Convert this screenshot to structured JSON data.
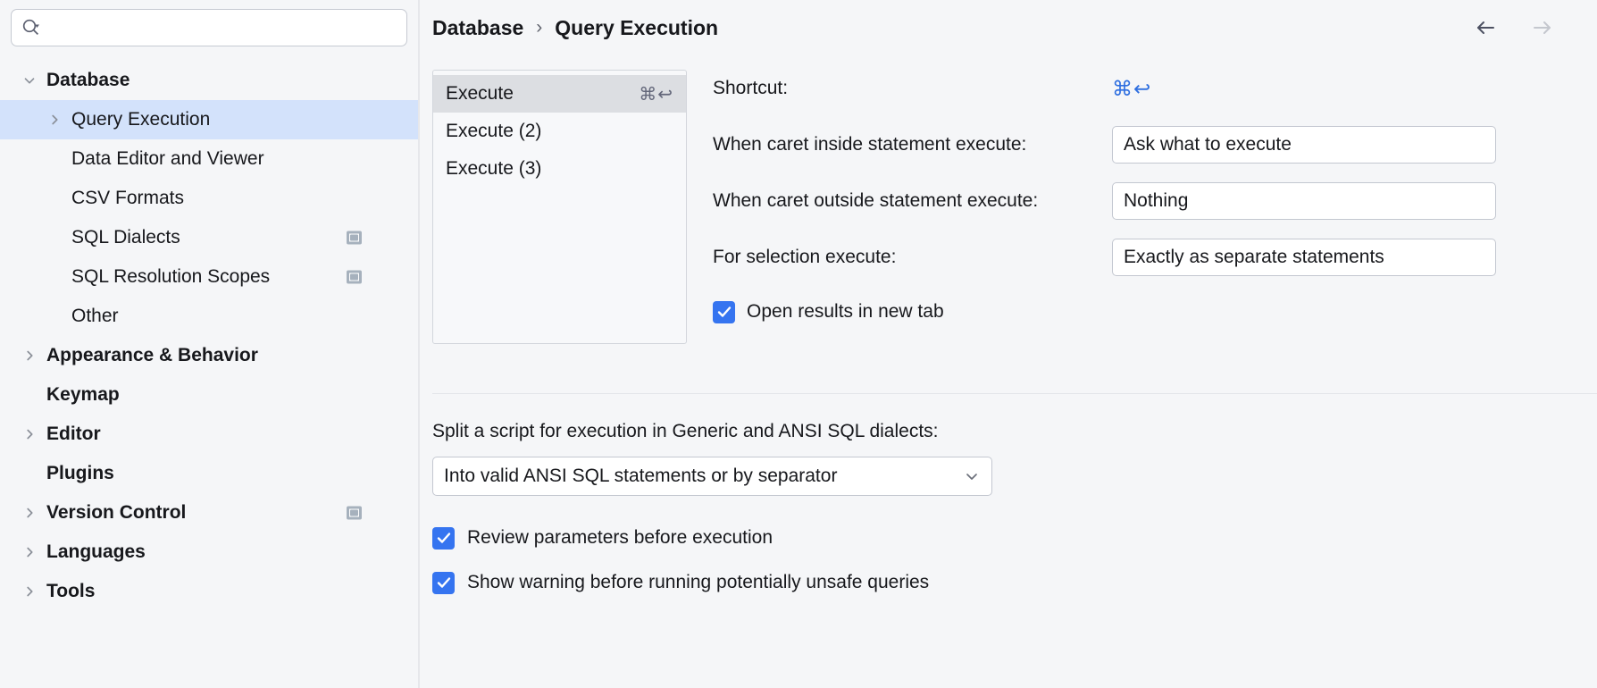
{
  "search": {
    "value": "",
    "placeholder": "",
    "icon": "search-icon"
  },
  "sidebar": {
    "items": [
      {
        "label": "Database",
        "level": 0,
        "bold": true,
        "twisty": "chevron-down",
        "selected": false,
        "badge": false
      },
      {
        "label": "Query Execution",
        "level": 1,
        "bold": false,
        "twisty": "chevron-right",
        "selected": true,
        "badge": false
      },
      {
        "label": "Data Editor and Viewer",
        "level": 1,
        "bold": false,
        "twisty": "none",
        "selected": false,
        "badge": false
      },
      {
        "label": "CSV Formats",
        "level": 1,
        "bold": false,
        "twisty": "none",
        "selected": false,
        "badge": false
      },
      {
        "label": "SQL Dialects",
        "level": 1,
        "bold": false,
        "twisty": "none",
        "selected": false,
        "badge": true
      },
      {
        "label": "SQL Resolution Scopes",
        "level": 1,
        "bold": false,
        "twisty": "none",
        "selected": false,
        "badge": true
      },
      {
        "label": "Other",
        "level": 1,
        "bold": false,
        "twisty": "none",
        "selected": false,
        "badge": false
      },
      {
        "label": "Appearance & Behavior",
        "level": 0,
        "bold": true,
        "twisty": "chevron-right",
        "selected": false,
        "badge": false
      },
      {
        "label": "Keymap",
        "level": 0,
        "bold": true,
        "twisty": "none",
        "selected": false,
        "badge": false
      },
      {
        "label": "Editor",
        "level": 0,
        "bold": true,
        "twisty": "chevron-right",
        "selected": false,
        "badge": false
      },
      {
        "label": "Plugins",
        "level": 0,
        "bold": true,
        "twisty": "none",
        "selected": false,
        "badge": false
      },
      {
        "label": "Version Control",
        "level": 0,
        "bold": true,
        "twisty": "chevron-right",
        "selected": false,
        "badge": true
      },
      {
        "label": "Languages",
        "level": 0,
        "bold": true,
        "twisty": "chevron-right",
        "selected": false,
        "badge": false
      },
      {
        "label": "Tools",
        "level": 0,
        "bold": true,
        "twisty": "chevron-right",
        "selected": false,
        "badge": false
      }
    ]
  },
  "breadcrumb": {
    "root": "Database",
    "separator": "›",
    "current": "Query Execution"
  },
  "nav": {
    "back_icon": "arrow-left-icon",
    "forward_icon": "arrow-right-icon",
    "back_enabled": true,
    "forward_enabled": false
  },
  "actions_list": {
    "items": [
      {
        "label": "Execute",
        "shortcut": "⌘↩",
        "selected": true
      },
      {
        "label": "Execute (2)",
        "shortcut": "",
        "selected": false
      },
      {
        "label": "Execute (3)",
        "shortcut": "",
        "selected": false
      }
    ]
  },
  "settings": {
    "shortcut_label": "Shortcut:",
    "shortcut_value": "⌘↩",
    "caret_inside_label": "When caret inside statement execute:",
    "caret_inside_value": "Ask what to execute",
    "caret_outside_label": "When caret outside statement execute:",
    "caret_outside_value": "Nothing",
    "selection_label": "For selection execute:",
    "selection_value": "Exactly as separate statements",
    "open_results_label": "Open results in new tab",
    "open_results_checked": true
  },
  "split_section": {
    "label": "Split a script for execution in Generic and ANSI SQL dialects:",
    "value": "Into valid ANSI SQL statements or by separator",
    "chevron_icon": "chevron-down-icon"
  },
  "bottom_options": [
    {
      "label": "Review parameters before execution",
      "checked": true
    },
    {
      "label": "Show warning before running potentially unsafe queries",
      "checked": true
    }
  ],
  "colors": {
    "accent": "#3574f0",
    "selection": "#d3e2fb",
    "list_selection": "#dcdee2",
    "background": "#f5f6f8",
    "shortcut_blue": "#2f6fe0"
  }
}
